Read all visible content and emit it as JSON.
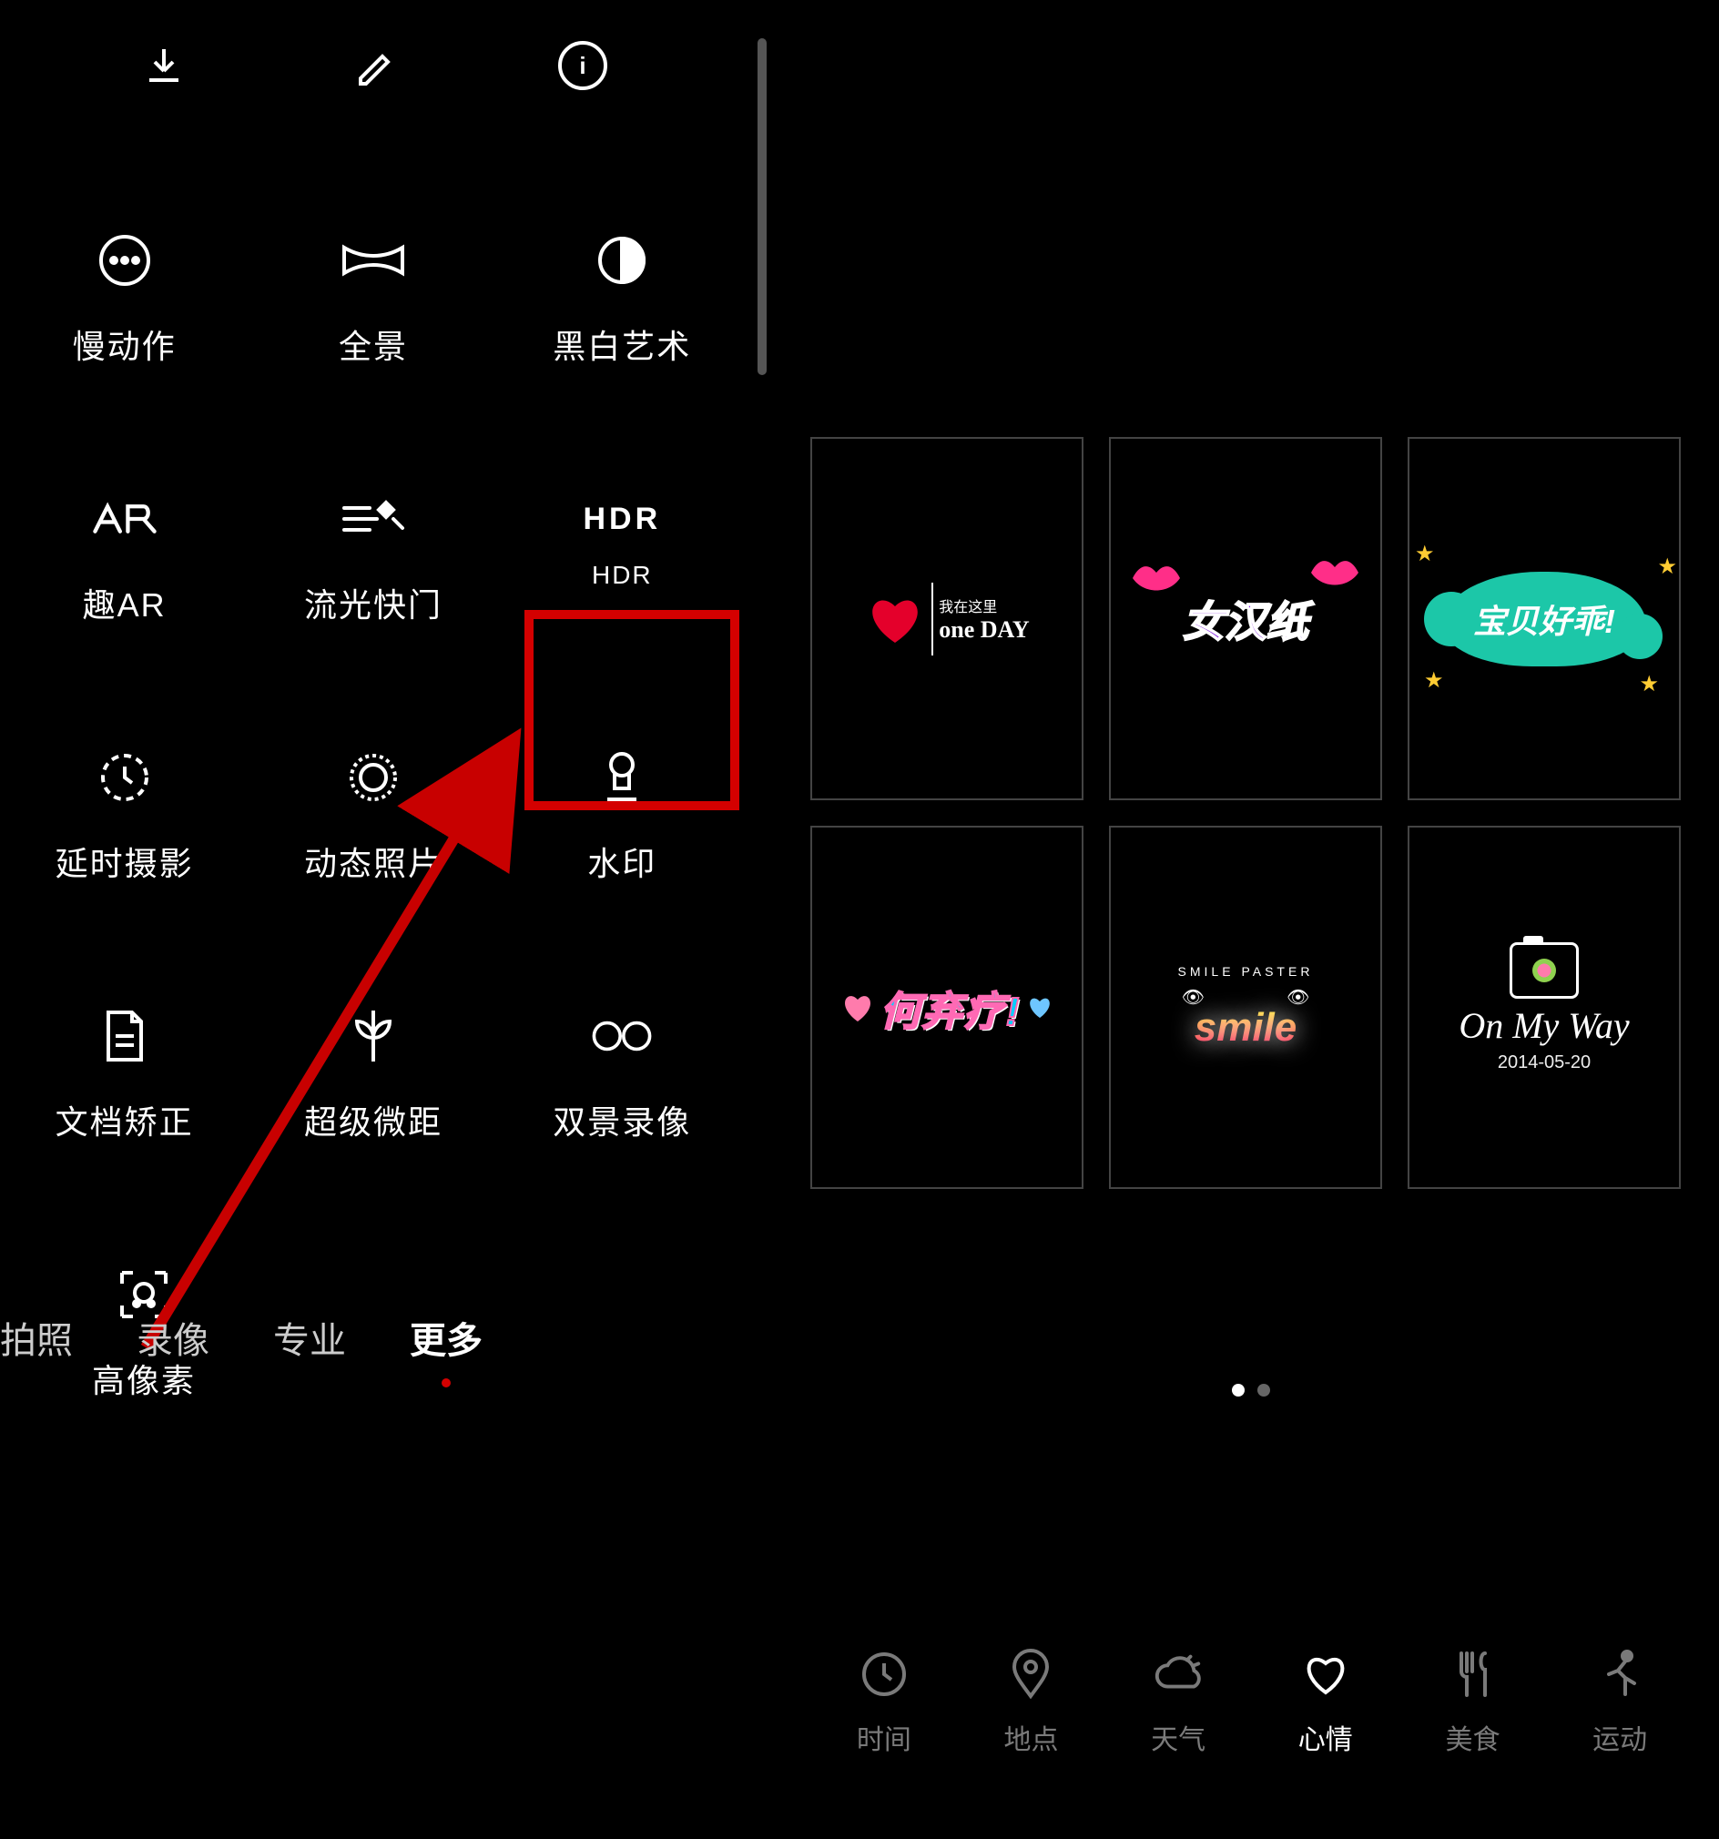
{
  "toolbar": {
    "download": "download-icon",
    "edit": "edit-icon",
    "info": "info-icon"
  },
  "mode_tabs": {
    "photo": "拍照",
    "video": "录像",
    "pro": "专业",
    "more": "更多"
  },
  "modes": {
    "slowmo": {
      "label": "慢动作"
    },
    "pano": {
      "label": "全景"
    },
    "bw": {
      "label": "黑白艺术"
    },
    "ar": {
      "label": "趣AR"
    },
    "light": {
      "label": "流光快门"
    },
    "hdr": {
      "label": "HDR",
      "sub": "HDR"
    },
    "timelapse": {
      "label": "延时摄影"
    },
    "moving": {
      "label": "动态照片"
    },
    "watermark": {
      "label": "水印"
    },
    "docscan": {
      "label": "文档矫正"
    },
    "macro": {
      "label": "超级微距"
    },
    "dual": {
      "label": "双景录像"
    },
    "highres": {
      "label": "高像素"
    }
  },
  "stickers": {
    "s1_top": "我在这里",
    "s1_main": "one DAY",
    "s2": "女汉纸",
    "s3": "宝贝好乖!",
    "s4": "何弃疗!",
    "s5_top": "SMILE  PASTER",
    "s5_main": "smile",
    "s6_main": "On My Way",
    "s6_date": "2014-05-20"
  },
  "categories": {
    "time": "时间",
    "place": "地点",
    "weather": "天气",
    "mood": "心情",
    "food": "美食",
    "sport": "运动"
  }
}
